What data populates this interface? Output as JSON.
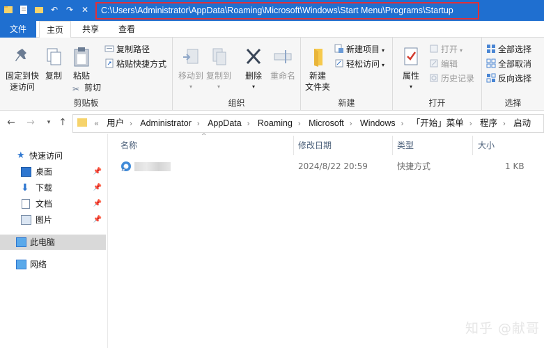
{
  "window": {
    "path": "C:\\Users\\Administrator\\AppData\\Roaming\\Microsoft\\Windows\\Start Menu\\Programs\\Startup"
  },
  "tabs": {
    "file": "文件",
    "home": "主页",
    "share": "共享",
    "view": "查看"
  },
  "ribbon": {
    "clipboard": {
      "label": "剪贴板",
      "pin": "固定到快\n速访问",
      "copy": "复制",
      "paste": "粘贴",
      "copy_path": "复制路径",
      "paste_shortcut": "粘贴快捷方式",
      "cut": "剪切"
    },
    "organize": {
      "label": "组织",
      "move_to": "移动到",
      "copy_to": "复制到",
      "delete": "删除",
      "rename": "重命名"
    },
    "new": {
      "label": "新建",
      "new_folder": "新建\n文件夹",
      "new_item": "新建项目",
      "easy_access": "轻松访问"
    },
    "open": {
      "label": "打开",
      "properties": "属性",
      "open": "打开",
      "edit": "编辑",
      "history": "历史记录"
    },
    "select": {
      "label": "选择",
      "select_all": "全部选择",
      "select_none": "全部取消",
      "invert": "反向选择"
    }
  },
  "address": {
    "overflow": "«",
    "crumbs": [
      "用户",
      "Administrator",
      "AppData",
      "Roaming",
      "Microsoft",
      "Windows",
      "「开始」菜单",
      "程序",
      "启动"
    ]
  },
  "nav": {
    "quick_access": "快速访问",
    "desktop": "桌面",
    "downloads": "下载",
    "documents": "文档",
    "pictures": "图片",
    "this_pc": "此电脑",
    "network": "网络"
  },
  "columns": {
    "name": "名称",
    "modified": "修改日期",
    "type": "类型",
    "size": "大小"
  },
  "files": [
    {
      "name": "",
      "modified": "2024/8/22 20:59",
      "type": "快捷方式",
      "size": "1 KB"
    }
  ],
  "watermark": "知乎 @献哥",
  "colors": {
    "titlebar": "#1f6fd0",
    "highlight": "#e0303a"
  }
}
